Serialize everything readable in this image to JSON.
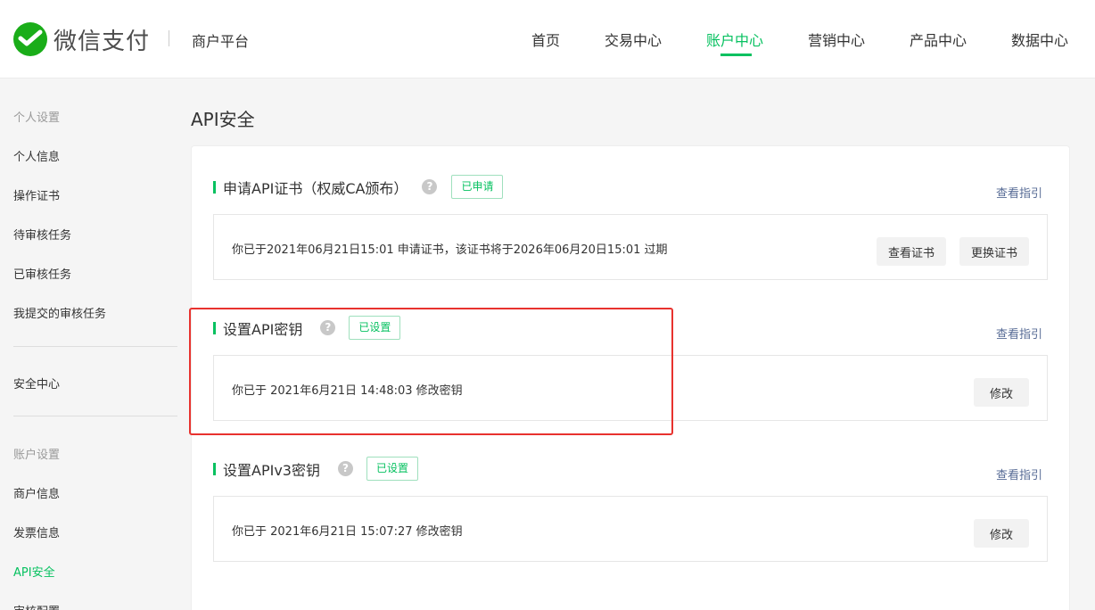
{
  "header": {
    "logo_text": "微信支付",
    "platform": "商户平台",
    "nav": [
      {
        "label": "首页",
        "active": false
      },
      {
        "label": "交易中心",
        "active": false
      },
      {
        "label": "账户中心",
        "active": true
      },
      {
        "label": "营销中心",
        "active": false
      },
      {
        "label": "产品中心",
        "active": false
      },
      {
        "label": "数据中心",
        "active": false
      }
    ]
  },
  "sidebar": {
    "group_personal": "个人设置",
    "personal_items": [
      "个人信息",
      "操作证书",
      "待审核任务",
      "已审核任务",
      "我提交的审核任务"
    ],
    "security_center": "安全中心",
    "group_account": "账户设置",
    "account_items": [
      "商户信息",
      "发票信息",
      "API安全",
      "审核配置"
    ],
    "active_item": "API安全"
  },
  "main": {
    "title": "API安全",
    "sections": [
      {
        "title": "申请API证书（权威CA颁布）",
        "badge": "已申请",
        "guide": "查看指引",
        "info": "你已于2021年06月21日15:01 申请证书，该证书将于2026年06月20日15:01 过期",
        "buttons": [
          "查看证书",
          "更换证书"
        ]
      },
      {
        "title": "设置API密钥",
        "badge": "已设置",
        "guide": "查看指引",
        "info": "你已于 2021年6月21日 14:48:03 修改密钥",
        "buttons": [
          "修改"
        ]
      },
      {
        "title": "设置APIv3密钥",
        "badge": "已设置",
        "guide": "查看指引",
        "info": "你已于 2021年6月21日 15:07:27 修改密钥",
        "buttons": [
          "修改"
        ]
      }
    ]
  },
  "icons": {
    "help": "?",
    "logo": "wechat-pay-logo-icon"
  },
  "colors": {
    "accent": "#07c160",
    "link": "#576b95",
    "highlight": "#e8322e"
  }
}
